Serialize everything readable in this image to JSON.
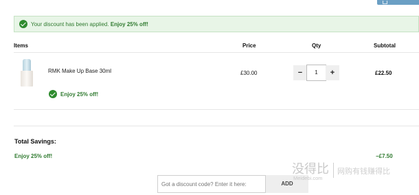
{
  "alert": {
    "message": "Your discount has been applied.",
    "highlight": "Enjoy 25% off!",
    "icon": "check-circle-icon",
    "color": "#2f7a2f"
  },
  "table": {
    "headers": {
      "items": "Items",
      "price": "Price",
      "qty": "Qty",
      "subtotal": "Subtotal"
    },
    "rows": [
      {
        "name": "RMK Make Up Base 30ml",
        "price": "£30.00",
        "qty": "1",
        "subtotal": "£22.50",
        "promo": "Enjoy 25% off!",
        "image": "product-bottle-image"
      }
    ]
  },
  "qty_controls": {
    "minus": "−",
    "plus": "+"
  },
  "savings": {
    "title": "Total Savings:",
    "label": "Enjoy 25% off!",
    "amount": "−£7.50"
  },
  "discount": {
    "placeholder": "Got a discount code? Enter it here:",
    "button": "ADD"
  },
  "watermark": {
    "main": "没得比",
    "url": "Meidebi.com",
    "slogan": "网购有钱赚得比"
  },
  "colors": {
    "success": "#2f7a2f",
    "alert_bg": "#e8f5e7",
    "top_button": "#6b9fc4"
  }
}
